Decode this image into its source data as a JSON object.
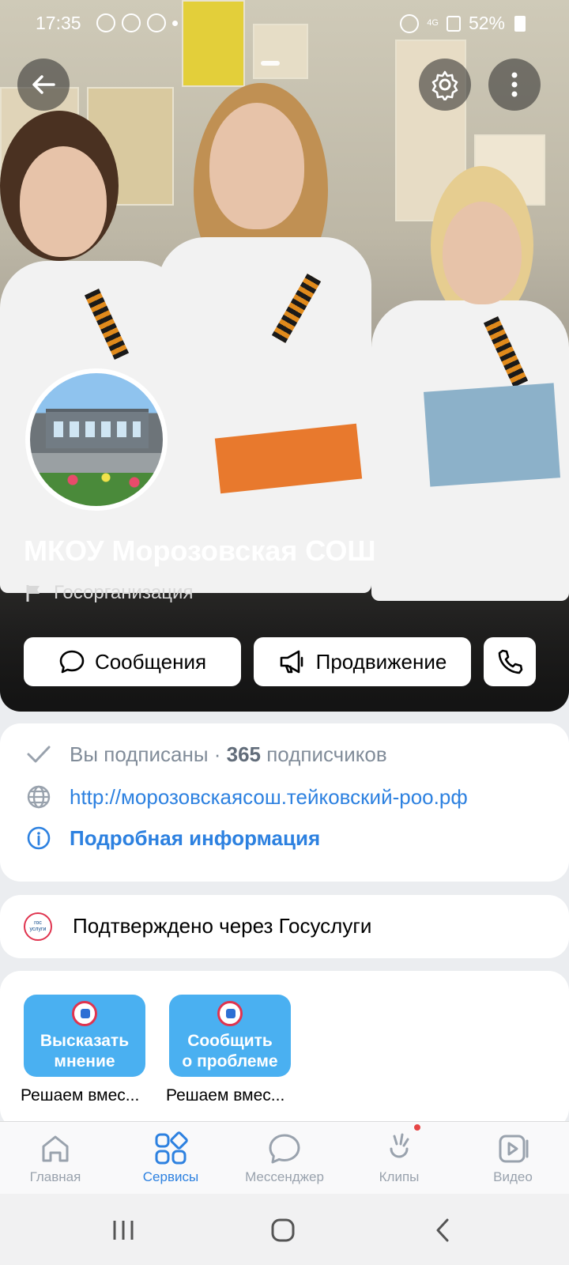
{
  "status_bar": {
    "time": "17:35",
    "battery": "52%",
    "network": "4G"
  },
  "group": {
    "name": "МКОУ Морозовская СОШ",
    "type": "Госорганизация"
  },
  "actions": {
    "messages": "Сообщения",
    "promotion": "Продвижение"
  },
  "info": {
    "subscribed": "Вы подписаны",
    "separator": " · ",
    "subscriber_count": "365",
    "subscribers_word": " подписчиков",
    "link": "http://морозовскаясош.тейковский-роо.рф",
    "details": "Подробная информация"
  },
  "gosuslugi": {
    "logo_text": "гос услуги",
    "text": "Подтверждено через Госуслуги"
  },
  "widgets": [
    {
      "label_line1": "Высказать",
      "label_line2": "мнение",
      "caption": "Решаем вмес..."
    },
    {
      "label_line1": "Сообщить",
      "label_line2": "о проблеме",
      "caption": "Решаем вмес..."
    }
  ],
  "tabs": [
    {
      "label": "Главная",
      "icon": "home-icon",
      "active": false
    },
    {
      "label": "Сервисы",
      "icon": "services-icon",
      "active": true
    },
    {
      "label": "Мессенджер",
      "icon": "messenger-icon",
      "active": false
    },
    {
      "label": "Клипы",
      "icon": "clips-icon",
      "active": false,
      "badge": true
    },
    {
      "label": "Видео",
      "icon": "video-icon",
      "active": false
    }
  ],
  "colors": {
    "accent": "#2d81e0",
    "widget_bg": "#4ab0f1",
    "badge": "#e64646",
    "gos_red": "#e0344f"
  }
}
